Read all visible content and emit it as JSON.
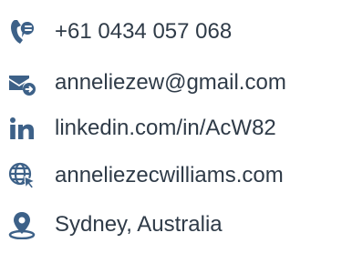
{
  "accent_color": "#3d6188",
  "text_color": "#2f3b48",
  "contacts": [
    {
      "type": "phone",
      "icon": "phone-icon",
      "text": "+61 0434 057 068"
    },
    {
      "type": "email",
      "icon": "email-icon",
      "text": "anneliezew@gmail.com"
    },
    {
      "type": "linkedin",
      "icon": "linkedin-icon",
      "text": "linkedin.com/in/AcW82"
    },
    {
      "type": "website",
      "icon": "globe-icon",
      "text": "anneliezecwilliams.com"
    },
    {
      "type": "location",
      "icon": "location-icon",
      "text": "Sydney, Australia"
    }
  ]
}
